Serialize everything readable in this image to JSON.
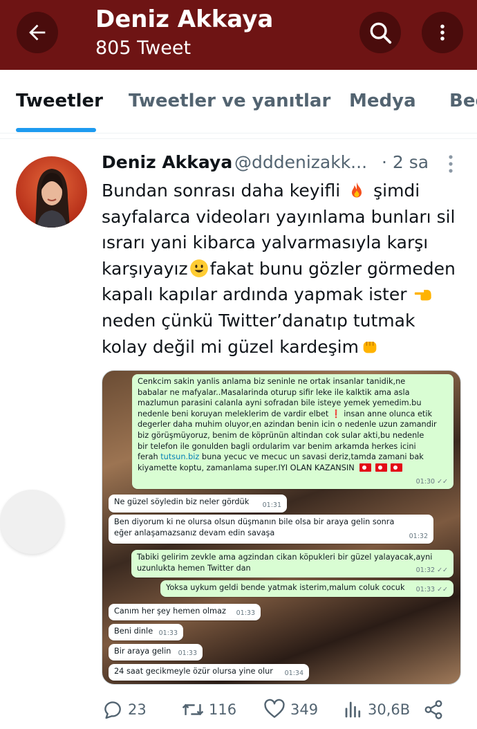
{
  "header": {
    "name": "Deniz Akkaya",
    "tweet_count": "805 Tweet",
    "background_color": "#6e1414"
  },
  "tabs": [
    {
      "label": "Tweetler",
      "active": true
    },
    {
      "label": "Tweetler ve yanıtlar",
      "active": false
    },
    {
      "label": "Medya",
      "active": false
    },
    {
      "label": "Beğ",
      "active": false
    }
  ],
  "tweet": {
    "author_name": "Deniz Akkaya",
    "handle": "@dddenizakk...",
    "time": "· 2 sa",
    "lines": [
      "Bundan sonrası daha keyifli",
      "şimdi",
      "sayfalarca videoları yayınlama bunları sil",
      "ısrarı yani kibarca yalvarmasıyla karşı",
      "karşıyayız",
      "fakat bunu gözler görmeden",
      "kapalı kapılar ardında yapmak ister",
      "neden çünkü Twitter’danatıp tutmak",
      "kolay değil mi güzel kardeşim"
    ],
    "image": {
      "messages": [
        {
          "dir": "out",
          "lines": [
            "Cenkcim sakin yanlis anlama biz seninle ne ortak insanlar tanidik,ne",
            "babalar ne mafyalar..Masalarinda oturup sifir leke ile kalktik ama asla",
            "mazlumun parasini calanla ayni sofradan bile isteye yemek yemedim.bu",
            "nedenle beni koruyan meleklerim de vardir elbet",
            "insan anne olunca etik",
            "degerler daha muhim oluyor,en azindan benin icin o nedenle uzun zamandir",
            "biz görüşmüyoruz, benim de köprünün altindan cok sular akti,bu nedenle",
            "bir telefon ile gonulden bagli ordularim var benim arkamda herkes icini",
            "ferah",
            "tutsun.biz",
            "buna yecuc ve mecuc un savasi deriz,tamda zamani bak",
            "kiyamette koptu, zamanlama super.IYI OLAN KAZANSIN"
          ],
          "time": "01:30 ✓✓"
        },
        {
          "dir": "in",
          "lines": [
            "Ne güzel söyledin biz neler gördük"
          ],
          "time": "01:31"
        },
        {
          "dir": "in",
          "lines": [
            "Ben diyorum ki ne olursa olsun düşmanın bile olsa bir araya gelin sonra",
            "eğer anlaşamazsanız devam edin savaşa"
          ],
          "time": "01:32"
        },
        {
          "dir": "out",
          "lines": [
            "Tabiki gelirim zevkle ama agzindan cikan köpukleri bir güzel yalayacak,ayni",
            "uzunlukta hemen Twitter dan"
          ],
          "time": "01:32 ✓✓"
        },
        {
          "dir": "out",
          "lines": [
            "Yoksa uykum geldi bende yatmak isterim,malum coluk cocuk"
          ],
          "time": "01:33 ✓✓"
        },
        {
          "dir": "in",
          "lines": [
            "Canım her şey hemen olmaz"
          ],
          "time": "01:33"
        },
        {
          "dir": "in",
          "lines": [
            "Beni dinle"
          ],
          "time": "01:33"
        },
        {
          "dir": "in",
          "lines": [
            "Bir araya gelin"
          ],
          "time": "01:33"
        },
        {
          "dir": "in",
          "lines": [
            "24 saat gecikmeyle özür olursa yine olur"
          ],
          "time": "01:34"
        }
      ]
    },
    "stats": {
      "replies": "23",
      "retweets": "116",
      "likes": "349",
      "views": "30,6B"
    }
  },
  "colors": {
    "accent": "#1d9bf0",
    "secondary_text": "#536471",
    "whatsapp_outgoing": "#d9fdd3",
    "whatsapp_incoming": "#ffffff",
    "whatsapp_link": "#027eb5"
  }
}
